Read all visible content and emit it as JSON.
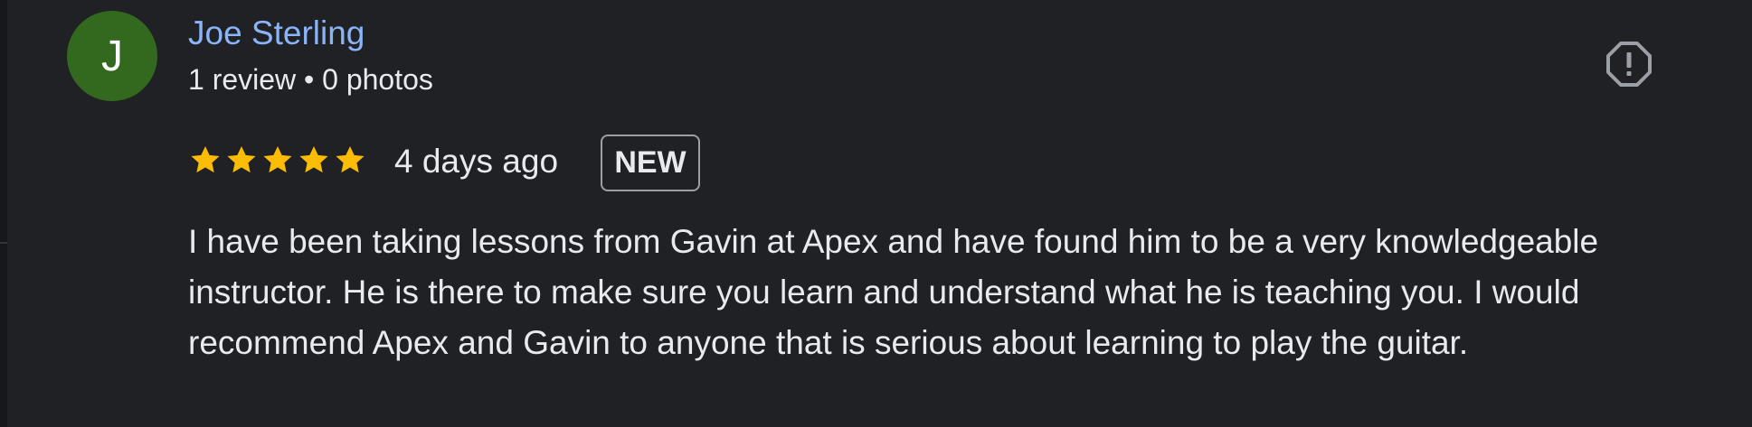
{
  "reviewer": {
    "initial": "J",
    "name": "Joe Sterling",
    "meta": "1 review • 0 photos",
    "avatar_color": "#33691e"
  },
  "review": {
    "rating": 5,
    "max_rating": 5,
    "date": "4 days ago",
    "badge": "NEW",
    "text": "I have been taking lessons from Gavin at Apex and have found him to be a very knowledgeable instructor. He is there to make sure you learn and understand what he is teaching you. I would recommend Apex and Gavin to anyone that is serious about learning to play the guitar."
  },
  "icons": {
    "report": "report-octagon-icon",
    "star": "star-icon"
  },
  "colors": {
    "background": "#202124",
    "name_link": "#8ab4f8",
    "star": "#fbbc04",
    "text": "#e8eaed"
  }
}
